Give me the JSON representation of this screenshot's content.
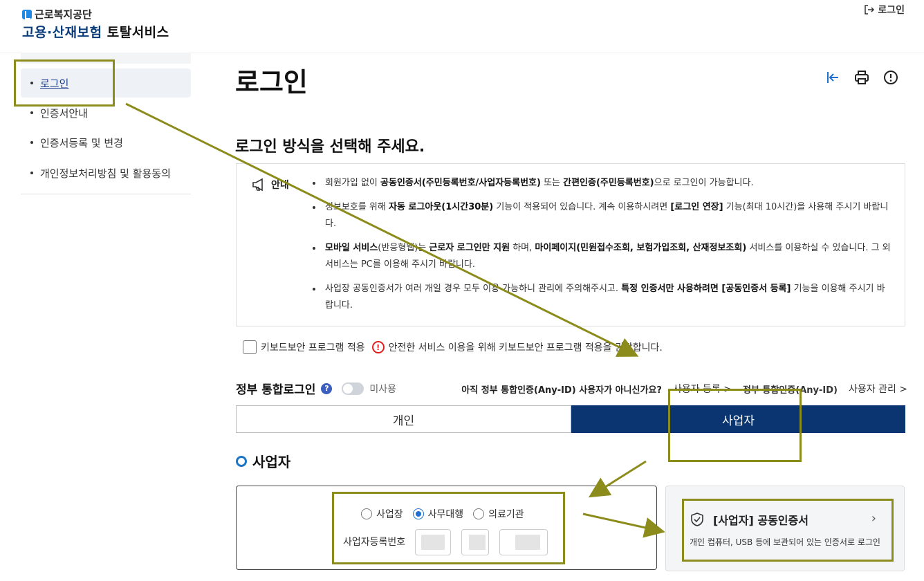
{
  "header": {
    "org_name": "근로복지공단",
    "service_name_blue": "고용·산재보험",
    "service_name_dark": "토탈서비스",
    "login_link": "로그인"
  },
  "sidebar": {
    "items": [
      {
        "label": "로그인",
        "active": true
      },
      {
        "label": "인증서안내"
      },
      {
        "label": "인증서등록 및 변경"
      },
      {
        "label": "개인정보처리방침 및 활용동의"
      }
    ]
  },
  "main": {
    "title": "로그인",
    "subtitle": "로그인 방식을 선택해 주세요.",
    "notice": {
      "heading": "안내",
      "items": [
        {
          "parts": [
            {
              "t": "회원가입 없이 "
            },
            {
              "t": "공동인증서(주민등록번호/사업자등록번호)",
              "b": true
            },
            {
              "t": " 또는 "
            },
            {
              "t": "간편인증(주민등록번호)",
              "b": true
            },
            {
              "t": "으로 로그인이 가능합니다."
            }
          ]
        },
        {
          "parts": [
            {
              "t": "정보보호를 위해 "
            },
            {
              "t": "자동 로그아웃(1시간30분)",
              "b": true
            },
            {
              "t": " 기능이 적용되어 있습니다. 계속 이용하시려면 "
            },
            {
              "t": "[로그인 연장]",
              "b": true
            },
            {
              "t": " 기능(최대 10시간)을 사용해 주시기 바랍니다."
            }
          ]
        },
        {
          "parts": [
            {
              "t": "모바일 서비스",
              "b": true
            },
            {
              "t": "(반응형웹)는 "
            },
            {
              "t": "근로자 로그인만 지원",
              "b": true
            },
            {
              "t": " 하며, "
            },
            {
              "t": "마이페이지(민원접수조회, 보험가입조회, 산재정보조회)",
              "b": true
            },
            {
              "t": " 서비스를 이용하실 수 있습니다. 그 외 서비스는 PC를 이용해 주시기 바랍니다."
            }
          ]
        },
        {
          "parts": [
            {
              "t": "사업장 공동인증서가 여러 개일 경우 모두 이용 가능하니 관리에 주의해주시고. "
            },
            {
              "t": "특정 인증서만 사용하려면 [공동인증서 등록]",
              "b": true
            },
            {
              "t": " 기능을 이용해 주시기 바랍니다."
            }
          ]
        }
      ]
    },
    "keyboard_security": {
      "label": "키보드보안 프로그램 적용",
      "warning": "안전한 서비스 이용을 위해 키보드보안 프로그램 적용을 권장합니다."
    },
    "gov_login": {
      "title": "정부 통합로그인",
      "help": "?",
      "toggle_state": "미사용",
      "question": "아직 정부 통합인증(Any-ID) 사용자가 아니신가요?",
      "link_register": "사용자 등록 >",
      "link_auth": "정부 통합인증(Any-ID)",
      "link_manage": "사용자 관리 >"
    },
    "tabs": [
      {
        "label": "개인",
        "selected": false
      },
      {
        "label": "사업자",
        "selected": true
      }
    ],
    "section_title": "사업자",
    "form": {
      "radios": [
        {
          "label": "사업장",
          "checked": false
        },
        {
          "label": "사무대행",
          "checked": true
        },
        {
          "label": "의료기관",
          "checked": false
        }
      ],
      "bizno_label": "사업자등록번호"
    },
    "cert_card": {
      "title": "[사업자] 공동인증서",
      "description": "개인 컴퓨터, USB 등에 보관되어 있는 인증서로 로그인",
      "chevron": "›"
    }
  },
  "colors": {
    "brand_navy": "#0b3570",
    "accent_blue": "#1e6fd0",
    "highlight_olive": "#8c8c1c",
    "warning_red": "#e02020"
  }
}
